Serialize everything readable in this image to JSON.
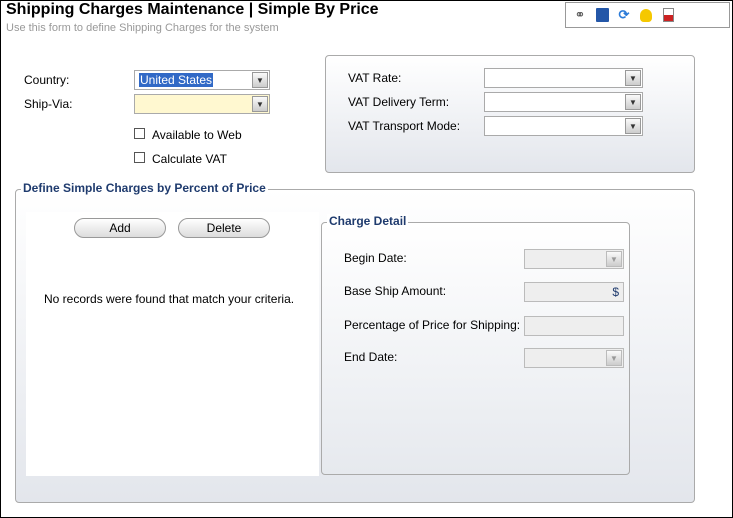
{
  "header": {
    "title": "Shipping Charges Maintenance | Simple By Price",
    "subtitle": "Use this form to define Shipping Charges for the system"
  },
  "toolbar": {
    "icons": [
      "binoculars-icon",
      "save-icon",
      "refresh-icon",
      "lightbulb-icon",
      "report-icon"
    ]
  },
  "form": {
    "country_label": "Country:",
    "country_value": "United States",
    "shipvia_label": "Ship-Via:",
    "shipvia_value": "",
    "available_web": "Available to Web",
    "calculate_vat": "Calculate VAT"
  },
  "vat": {
    "rate_label": "VAT Rate:",
    "delivery_label": "VAT Delivery Term:",
    "transport_label": "VAT Transport Mode:"
  },
  "charges": {
    "legend": "Define Simple Charges by Percent of Price",
    "add": "Add",
    "delete": "Delete",
    "empty": "No records were found that match your criteria."
  },
  "detail": {
    "legend": "Charge Detail",
    "begin": "Begin Date:",
    "base": "Base Ship Amount:",
    "currency": "$",
    "pct": "Percentage of Price for Shipping:",
    "end": "End Date:"
  },
  "colors": {
    "highlight": "#3169c6",
    "required": "#fff8d0"
  }
}
